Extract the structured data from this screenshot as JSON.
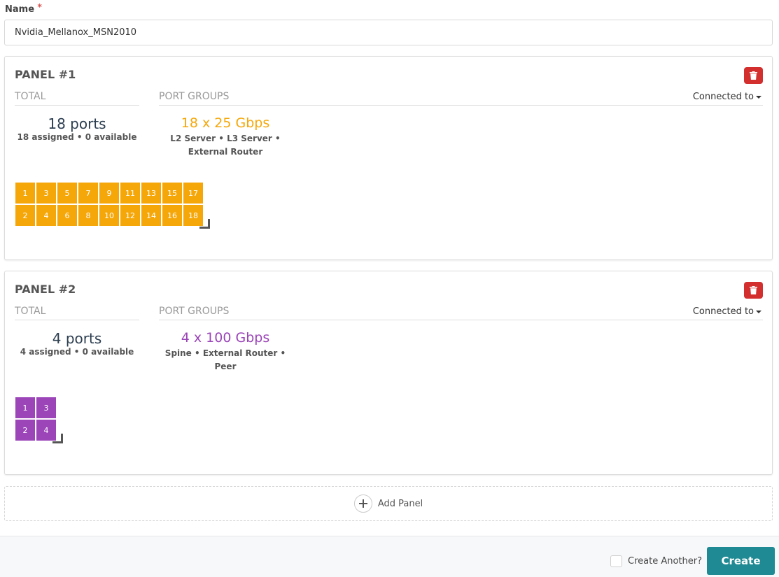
{
  "form": {
    "name_label": "Name",
    "required_mark": "*",
    "name_value": "Nvidia_Mellanox_MSN2010"
  },
  "panels": [
    {
      "title": "PANEL #1",
      "total_header": "TOTAL",
      "groups_header": "PORT GROUPS",
      "connected_label": "Connected to",
      "total_ports": "18 ports",
      "total_sub": "18 assigned • 0 available",
      "group_speed": "18 x 25 Gbps",
      "group_roles_1": "L2 Server • L3 Server •",
      "group_roles_2": "External Router",
      "color": "#f5a70a",
      "ports_top": [
        "1",
        "3",
        "5",
        "7",
        "9",
        "11",
        "13",
        "15",
        "17"
      ],
      "ports_bottom": [
        "2",
        "4",
        "6",
        "8",
        "10",
        "12",
        "14",
        "16",
        "18"
      ]
    },
    {
      "title": "PANEL #2",
      "total_header": "TOTAL",
      "groups_header": "PORT GROUPS",
      "connected_label": "Connected to",
      "total_ports": "4 ports",
      "total_sub": "4 assigned • 0 available",
      "group_speed": "4 x 100 Gbps",
      "group_roles_1": "Spine • External Router •",
      "group_roles_2": "Peer",
      "color": "#9b45b8",
      "ports_top": [
        "1",
        "3"
      ],
      "ports_bottom": [
        "2",
        "4"
      ]
    }
  ],
  "add_panel_label": "Add Panel",
  "footer": {
    "create_another_label": "Create Another?",
    "create_label": "Create"
  },
  "icons": {
    "delete": "trash-icon",
    "add": "plus-icon",
    "dropdown": "caret-down-icon"
  },
  "colors": {
    "danger": "#d32f2f",
    "primary": "#1f8a93"
  }
}
